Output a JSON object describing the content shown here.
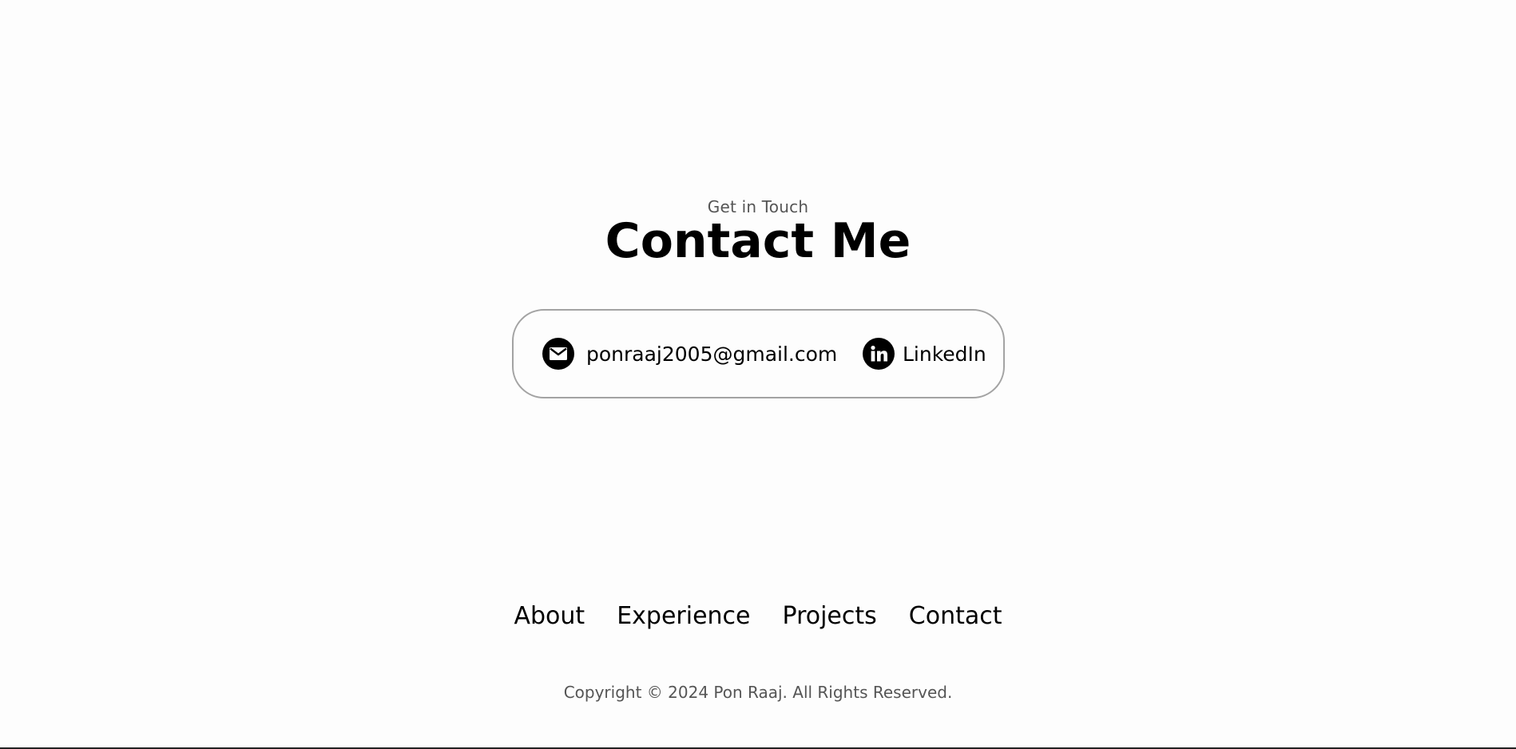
{
  "contact_section": {
    "subtitle": "Get in Touch",
    "title": "Contact Me",
    "email": {
      "icon": "email-icon",
      "label": "ponraaj2005@gmail.com"
    },
    "linkedin": {
      "icon": "linkedin-icon",
      "label": "LinkedIn"
    }
  },
  "footer": {
    "nav": [
      {
        "label": "About"
      },
      {
        "label": "Experience"
      },
      {
        "label": "Projects"
      },
      {
        "label": "Contact"
      }
    ],
    "copyright": "Copyright © 2024 Pon Raaj. All Rights Reserved."
  },
  "colors": {
    "background": "#fdfdfd",
    "text": "#000000",
    "muted_text": "#555555",
    "box_border": "#a3a3a3"
  }
}
